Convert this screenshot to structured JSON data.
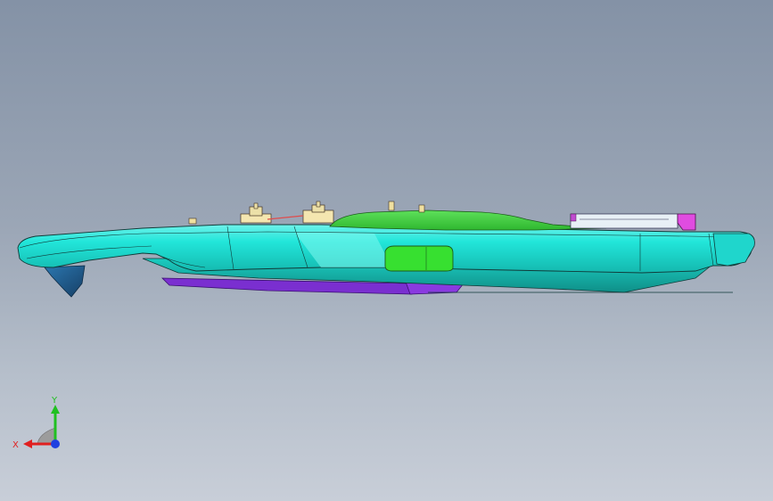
{
  "viewport": {
    "name": "3d-graphics-area"
  },
  "model": {
    "colors": {
      "main_body": "#22e6da",
      "main_body_shade": "#1cc6bc",
      "highlight": "#7ff7ef",
      "top_part": "#3fd64a",
      "window_part": "#37e030",
      "underside": "#7a2fd0",
      "front_keel": "#1f5a8c",
      "edge_lines": "#103a38",
      "bracket_pink": "#e04ce0"
    }
  },
  "triad": {
    "x_label": "X",
    "y_label": "Y",
    "x_color": "#e02020",
    "y_color": "#20c020",
    "z_color": "#2040e0"
  }
}
